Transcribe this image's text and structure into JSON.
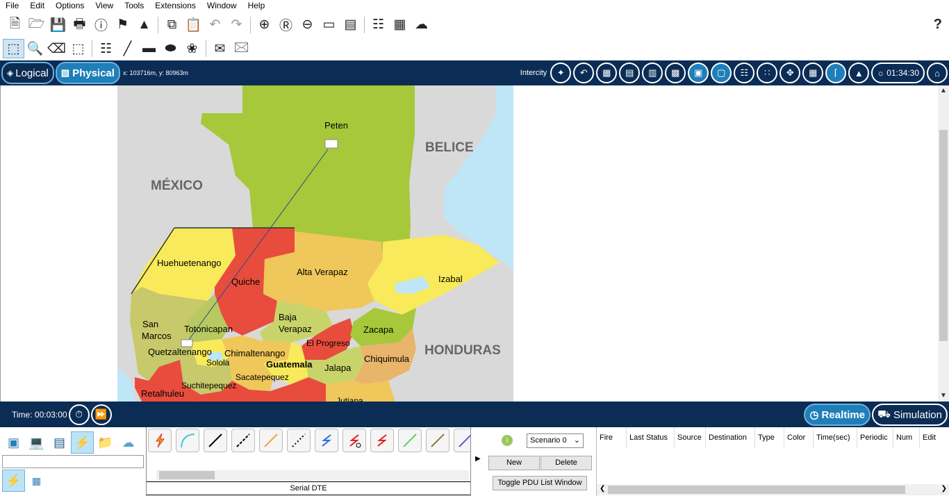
{
  "menu": [
    "File",
    "Edit",
    "Options",
    "View",
    "Tools",
    "Extensions",
    "Window",
    "Help"
  ],
  "toolbar": {
    "help_label": "?"
  },
  "nav": {
    "logical_label": "Logical",
    "physical_label": "Physical",
    "coords": "x: 103716m, y: 80963m",
    "intercity_label": "Intercity",
    "clock": "01:34:30"
  },
  "map": {
    "countries": [
      "MÉXICO",
      "BELICE",
      "HONDURAS"
    ],
    "departments": [
      "Peten",
      "Huehuetenango",
      "Quiche",
      "Alta Verapaz",
      "Izabal",
      "San",
      "Marcos",
      "Totonicapan",
      "Baja",
      "Verapaz",
      "Zacapa",
      "El Progreso",
      "Quetzaltenango",
      "Chimaltenango",
      "Solola",
      "Guatemala",
      "Chiquimula",
      "Jalapa",
      "Sacatepequez",
      "Suchitepequez",
      "Retalhuleu",
      "Jutiapa"
    ]
  },
  "timebar": {
    "time": "Time: 00:03:00",
    "realtime_label": "Realtime",
    "simulation_label": "Simulation"
  },
  "devices": {
    "connection_name": "Serial DTE"
  },
  "pdu": {
    "scenario": "Scenario 0",
    "new_label": "New",
    "delete_label": "Delete",
    "toggle_label": "Toggle PDU List Window",
    "columns": [
      "Fire",
      "Last Status",
      "Source",
      "Destination",
      "Type",
      "Color",
      "Time(sec)",
      "Periodic",
      "Num",
      "Edit"
    ]
  },
  "colors": {
    "nav_bg": "#0b2c54",
    "accent": "#1f7fb8"
  }
}
